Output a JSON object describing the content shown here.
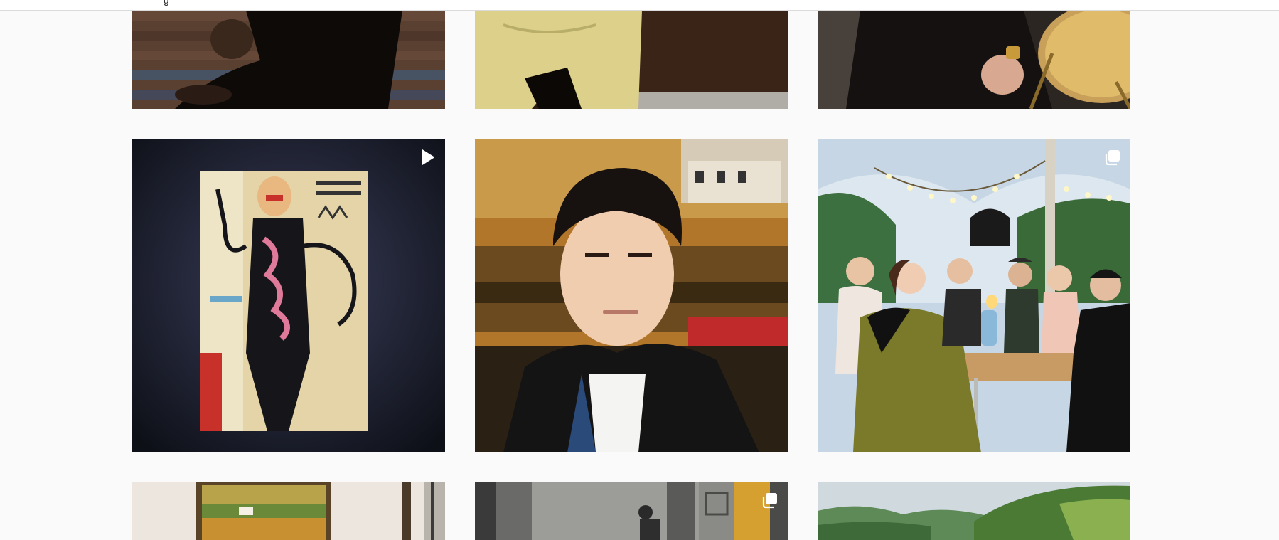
{
  "topbar": {
    "cut_text": "g"
  },
  "grid": {
    "rows": [
      {
        "tiles": [
          {
            "name": "post-dog-on-deck",
            "badge": "none",
            "palette": [
              "#3b2a22",
              "#6b4a3a",
              "#1a1410"
            ]
          },
          {
            "name": "post-yellow-pants",
            "badge": "none",
            "palette": [
              "#d8cf8a",
              "#2a1c14",
              "#9a948a"
            ]
          },
          {
            "name": "post-black-dog-hand",
            "badge": "none",
            "palette": [
              "#1d1a18",
              "#b08a3a",
              "#6d5a4a"
            ]
          }
        ]
      },
      {
        "tiles": [
          {
            "name": "post-basquiat-painting",
            "badge": "play-icon",
            "palette": [
              "#1e2030",
              "#e6d6b0",
              "#c8302a"
            ]
          },
          {
            "name": "post-selfie-painting-bg",
            "badge": "none",
            "palette": [
              "#b87a2a",
              "#1a1a1c",
              "#f1d7c4"
            ]
          },
          {
            "name": "post-group-dinner-tent",
            "badge": "carousel-icon",
            "palette": [
              "#bcd0e0",
              "#3f6a3a",
              "#8a7a3a"
            ]
          }
        ]
      },
      {
        "tiles": [
          {
            "name": "post-framed-landscape",
            "badge": "none",
            "palette": [
              "#efe9e2",
              "#b49a4a",
              "#4a3a2a"
            ]
          },
          {
            "name": "post-patterned-wall-person",
            "badge": "carousel-icon",
            "palette": [
              "#8a8a86",
              "#d4a030",
              "#2a2a2a"
            ]
          },
          {
            "name": "post-mountain-forest",
            "badge": "none",
            "palette": [
              "#cfd8dc",
              "#4d7a3a",
              "#8ab05a"
            ]
          }
        ]
      }
    ]
  }
}
